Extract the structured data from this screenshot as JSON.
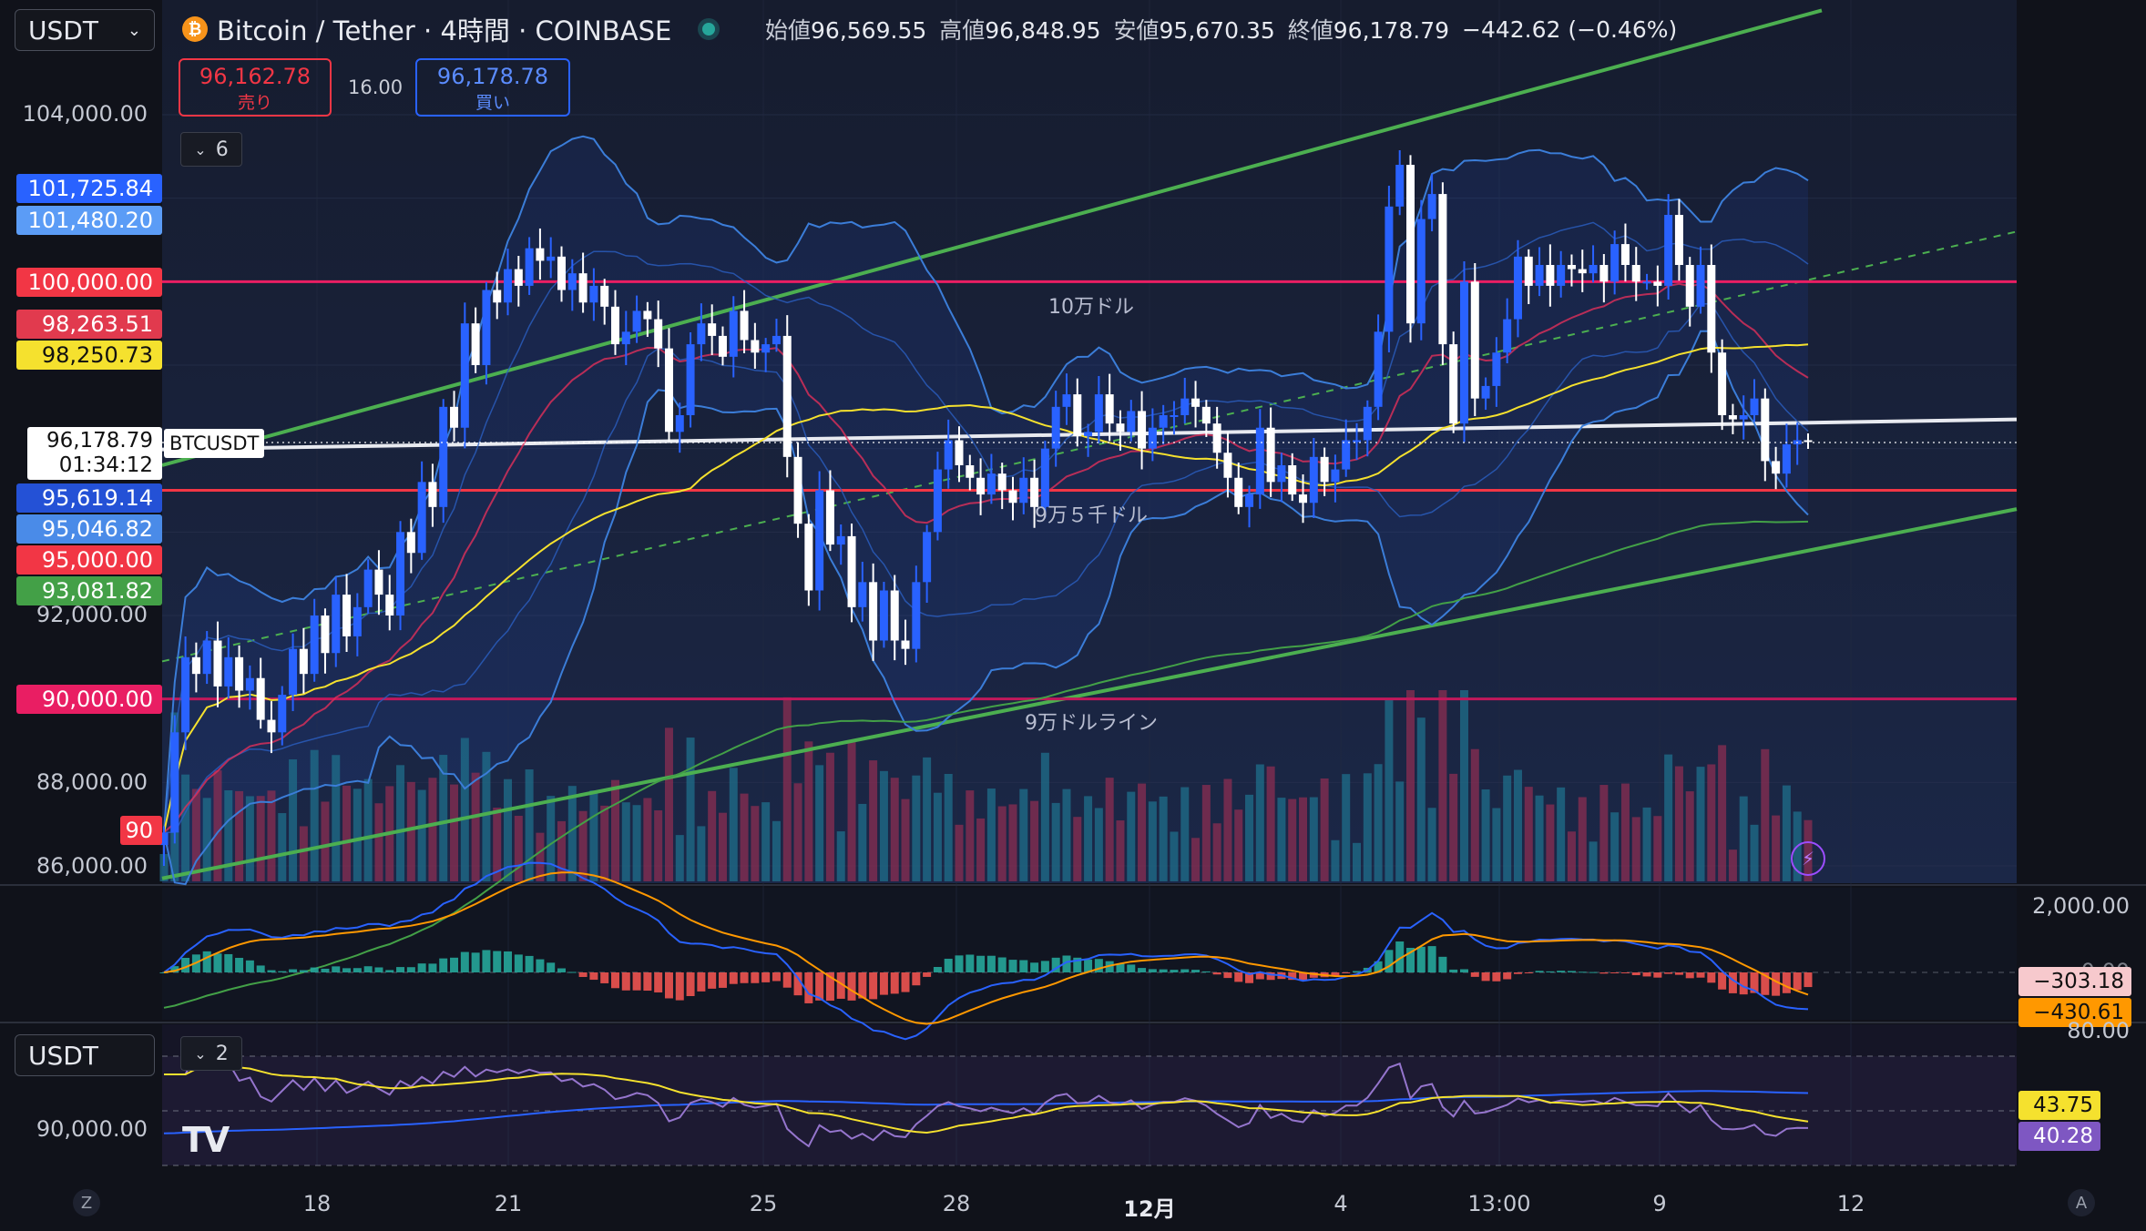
{
  "header": {
    "quote_select": "USDT",
    "symbol_title": "Bitcoin / Tether · 4時間 · COINBASE",
    "ohlc": [
      {
        "label": "始値",
        "value": "96,569.55"
      },
      {
        "label": "高値",
        "value": "96,848.95"
      },
      {
        "label": "安値",
        "value": "95,670.35"
      },
      {
        "label": "終値",
        "value": "96,178.79"
      }
    ],
    "change": "−442.62 (−0.46%)",
    "sell": {
      "price": "96,162.78",
      "label": "売り"
    },
    "spread": "16.00",
    "buy": {
      "price": "96,178.78",
      "label": "買い"
    },
    "collapse_count": "6"
  },
  "price_axis": {
    "ticks": [
      "104,000.00",
      "92,000.00",
      "88,000.00",
      "86,000.00"
    ],
    "tags": [
      {
        "text": "101,725.84",
        "color": "#2962ff"
      },
      {
        "text": "101,480.20",
        "color": "#5b9cf6"
      },
      {
        "text": "100,000.00",
        "color": "#f23645"
      },
      {
        "text": "98,263.51",
        "color": "#e13a4e"
      },
      {
        "text": "98,250.73",
        "color": "#f5e12e",
        "text_color": "#111111"
      },
      {
        "text": "95,619.14",
        "color": "#2451d6"
      },
      {
        "text": "95,046.82",
        "color": "#4a8be8"
      },
      {
        "text": "95,000.00",
        "color": "#f23645"
      },
      {
        "text": "93,081.82",
        "color": "#43a047"
      },
      {
        "text": "90,000.00",
        "color": "#e91e63"
      },
      {
        "text": "90",
        "color": "#f23645"
      }
    ],
    "current": {
      "price": "96,178.79",
      "countdown": "01:34:12",
      "symbol": "BTCUSDT"
    }
  },
  "annotations": {
    "h100k": "10万ドル",
    "h95k": "9万５千ドル",
    "h90k": "9万ドルライン"
  },
  "macd_axis": {
    "top": "2,000.00",
    "mid": "0.00",
    "tag1": "−303.18",
    "tag2": "−430.61"
  },
  "rsi_panel": {
    "select": "USDT",
    "collapse_count": "2",
    "axis_top": "80.00",
    "axis_left": "90,000.00",
    "tag1": "43.75",
    "tag2": "40.28"
  },
  "time_axis": {
    "labels": [
      "18",
      "21",
      "25",
      "28",
      "12月",
      "4",
      "13:00",
      "9",
      "12"
    ],
    "left_btn": "Z",
    "right_btn": "A"
  },
  "colors": {
    "up": "#2962ff",
    "down": "#ffffff",
    "channel": "#4caf50",
    "bb": "#3b7dd8",
    "ema_short": "#f23645",
    "ema_long": "#f5e12e",
    "accent": "#2962ff"
  },
  "chart_data": {
    "type": "candlestick",
    "symbol": "BTCUSDT",
    "timeframe": "4h",
    "ylim": [
      85600,
      105500
    ],
    "closes": [
      86800,
      89200,
      91000,
      90600,
      91400,
      90300,
      91000,
      90200,
      90500,
      89500,
      89200,
      90100,
      91200,
      90600,
      92000,
      91100,
      92500,
      91500,
      92200,
      93100,
      92500,
      92000,
      94000,
      93500,
      95200,
      94600,
      97000,
      96500,
      99000,
      98000,
      99800,
      99500,
      100300,
      99900,
      100800,
      100500,
      100600,
      99800,
      100200,
      99500,
      99900,
      99400,
      98500,
      98800,
      99300,
      99100,
      98400,
      96400,
      96800,
      98500,
      99000,
      98700,
      98200,
      99300,
      98600,
      98300,
      98500,
      98700,
      95800,
      94200,
      92600,
      95000,
      93700,
      93900,
      92200,
      92800,
      91400,
      92600,
      91400,
      91200,
      92800,
      94000,
      95500,
      96200,
      95600,
      95300,
      94900,
      95400,
      95000,
      94700,
      95300,
      94600,
      96000,
      97000,
      97300,
      96300,
      96400,
      97300,
      96600,
      96400,
      96900,
      96000,
      96500,
      96800,
      96800,
      97200,
      97000,
      96600,
      95900,
      95300,
      94600,
      94900,
      96500,
      95200,
      95600,
      94900,
      94700,
      95800,
      95200,
      95500,
      96200,
      96200,
      97000,
      98800,
      101800,
      102800,
      99000,
      101500,
      102100,
      98500,
      96600,
      100000,
      97200,
      97500,
      98300,
      99100,
      100600,
      99900,
      100400,
      99900,
      100400,
      100300,
      100200,
      100400,
      100000,
      100900,
      100400,
      100000,
      100000,
      99900,
      101600,
      100400,
      99400,
      100400,
      98300,
      96800,
      96700,
      96800,
      97200,
      95700,
      95400,
      96100,
      96200,
      96178.79
    ],
    "bb_upper_end": 101725.84,
    "bb_lower_end": 95046.82,
    "ema_short_end": 98263.51,
    "ema_long_end": 98250.73,
    "sma200_end": 93081.82,
    "horizontal_levels": [
      100000,
      95000,
      90000
    ],
    "macd": {
      "macd": -303.18,
      "signal": -430.61
    },
    "rsi": {
      "rsi": 43.75,
      "rsi_ma": 40.28
    }
  }
}
